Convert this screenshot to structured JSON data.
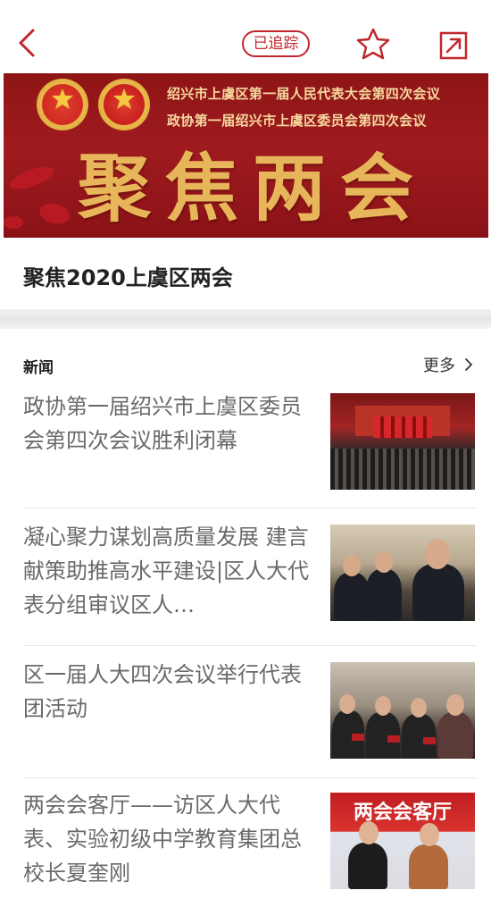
{
  "header": {
    "track_label": "已追踪"
  },
  "banner": {
    "line1": "绍兴市上虞区第一届人民代表大会第四次会议",
    "line2": "政协第一届绍兴市上虞区委员会第四次会议",
    "headline": "聚焦两会"
  },
  "topic": {
    "title": "聚焦2020上虞区两会"
  },
  "news": {
    "section_label": "新闻",
    "more_label": "更多",
    "items": [
      {
        "title": "政协第一届绍兴市上虞区委员会第四次会议胜利闭幕"
      },
      {
        "title": "凝心聚力谋划高质量发展 建言献策助推高水平建设|区人大代表分组审议区人…"
      },
      {
        "title": "区一届人大四次会议举行代表团活动"
      },
      {
        "title": "两会会客厅——访区人大代表、实验初级中学教育集团总校长夏奎刚"
      }
    ],
    "thumb4_caption": "两会会客厅"
  },
  "colors": {
    "accent": "#c0272d",
    "banner_red": "#9f1b1f",
    "banner_gold": "#e8b65a"
  },
  "icons": [
    "back-arrow-icon",
    "star-icon",
    "share-icon",
    "chevron-right-icon"
  ]
}
